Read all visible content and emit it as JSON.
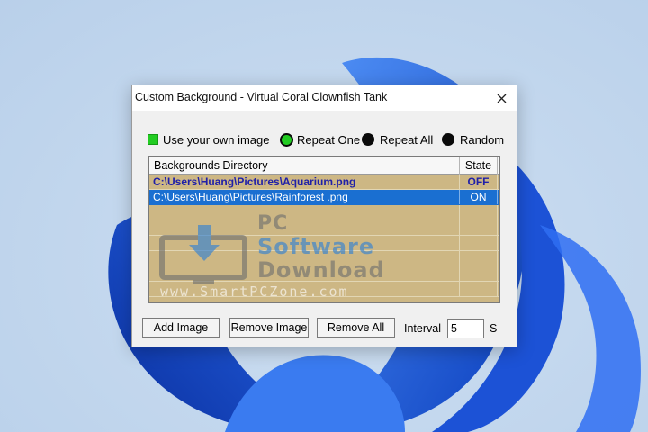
{
  "window": {
    "title": "Custom Background - Virtual Coral Clownfish Tank"
  },
  "options": {
    "use_own_image": "Use your own image",
    "repeat_one": "Repeat One",
    "repeat_all": "Repeat All",
    "random": "Random",
    "selected_mode": "Repeat One"
  },
  "list": {
    "columns": [
      "Backgrounds Directory",
      "State"
    ],
    "rows": [
      {
        "path": "C:\\Users\\Huang\\Pictures\\Aquarium.png",
        "state": "OFF"
      },
      {
        "path": "C:\\Users\\Huang\\Pictures\\Rainforest .png",
        "state": "ON"
      }
    ],
    "selected_row": 1
  },
  "buttons": {
    "add": "Add Image",
    "remove": "Remove Image",
    "remove_all": "Remove All"
  },
  "interval": {
    "label": "Interval",
    "value": "5",
    "unit": "S"
  },
  "watermark": {
    "line1": "PC",
    "line2": "Software",
    "line3": "Download",
    "line4": "www.SmartPCZone.com"
  },
  "colors": {
    "list_background": "#cdb784",
    "selection": "#1a6fd1",
    "active_indicator": "#22cc22",
    "wallpaper_accent": "#1f5fe0"
  }
}
